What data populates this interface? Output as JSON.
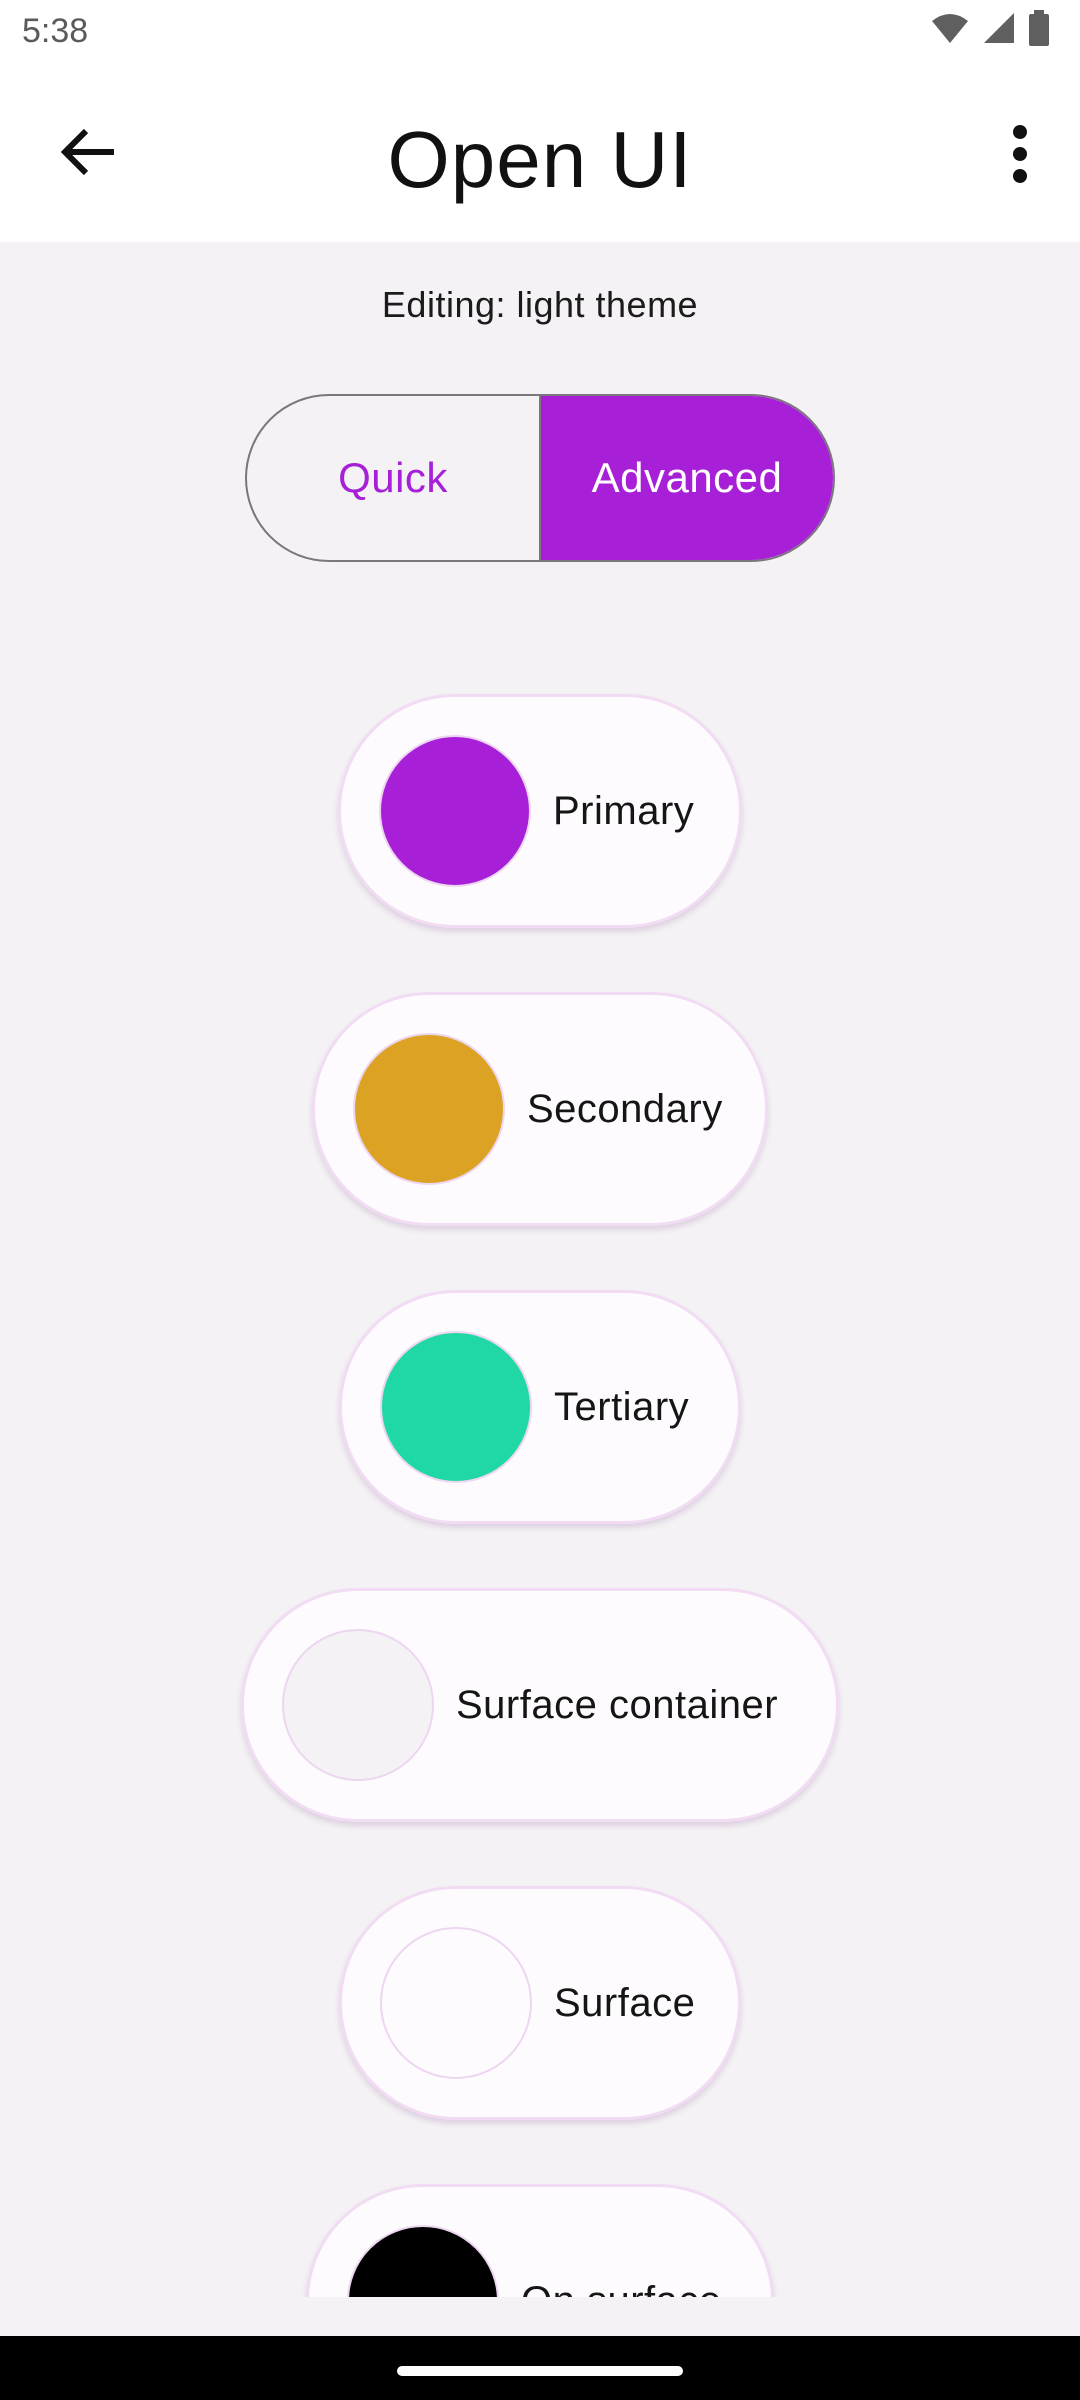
{
  "status": {
    "time": "5:38"
  },
  "app_bar": {
    "title": "Open UI"
  },
  "editing_label": "Editing: light theme",
  "mode_toggle": {
    "quick_label": "Quick",
    "advanced_label": "Advanced",
    "selected": "Advanced"
  },
  "colors": {
    "accent": "#a720d8",
    "primary": "#a720d8",
    "secondary": "#dba223",
    "tertiary": "#20d8a3",
    "surface_container": "#f4f2f4",
    "surface": "#fdfbfd",
    "on_surface": "#000000"
  },
  "chips": [
    {
      "label": "Primary",
      "color": "#a720d8"
    },
    {
      "label": "Secondary",
      "color": "#dba223"
    },
    {
      "label": "Tertiary",
      "color": "#20d8a3"
    },
    {
      "label": "Surface container",
      "color": "#f4f2f4"
    },
    {
      "label": "Surface",
      "color": "#fdfbfd"
    },
    {
      "label": "On surface",
      "color": "#000000"
    }
  ],
  "icons": {
    "back": "arrow-back-icon",
    "more": "more-vert-icon",
    "wifi": "wifi-icon",
    "signal": "signal-icon",
    "battery": "battery-icon"
  }
}
